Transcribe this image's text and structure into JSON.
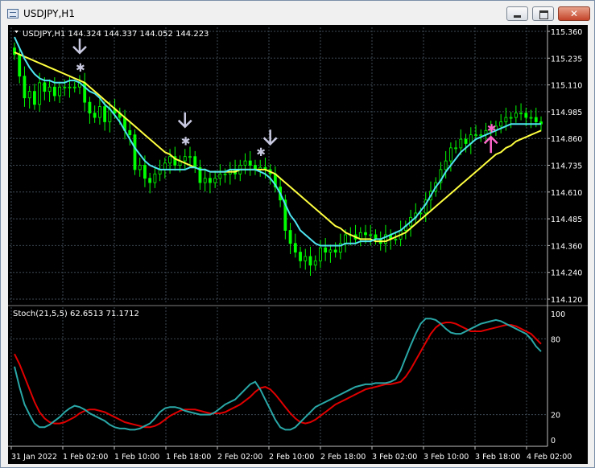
{
  "window": {
    "title": "USDJPY,H1",
    "minimize_label": "",
    "maximize_label": "",
    "close_label": "✕"
  },
  "colors": {
    "background": "#000000",
    "grid": "#3e4a55",
    "axis_text": "#ffffff",
    "bull_candle": "#00ff00",
    "ma_fast": "#4ee4f0",
    "ma_slow": "#ffff40",
    "stoch_main": "#2aa7a7",
    "stoch_signal": "#e00000",
    "signal_sell": "#c8c8e0",
    "signal_buy": "#ff66cc"
  },
  "price_panel": {
    "header": "USDJPY,H1  144.324 144.337 144.052 144.223",
    "price_labels": [
      "115.360",
      "115.235",
      "115.110",
      "114.985",
      "114.860",
      "114.735",
      "114.610",
      "114.485",
      "114.360",
      "114.240",
      "114.120"
    ],
    "signals": [
      {
        "type": "sell-arrow",
        "index": 13
      },
      {
        "type": "sell-arrow",
        "index": 34
      },
      {
        "type": "sell-arrow",
        "index": 51
      },
      {
        "type": "star",
        "index": 13
      },
      {
        "type": "star",
        "index": 34
      },
      {
        "type": "star",
        "index": 49
      },
      {
        "type": "buy-arrow",
        "index": 95
      },
      {
        "type": "buy-star",
        "index": 95
      }
    ]
  },
  "stoch_panel": {
    "header": "Stoch(21,5,5) 62.6513 71.1712",
    "levels": [
      "100",
      "80",
      "20",
      "0"
    ]
  },
  "time_labels": [
    "31 Jan 2022",
    "1 Feb 02:00",
    "1 Feb 10:00",
    "1 Feb 18:00",
    "2 Feb 02:00",
    "2 Feb 10:00",
    "2 Feb 18:00",
    "3 Feb 02:00",
    "3 Feb 10:00",
    "3 Feb 18:00",
    "4 Feb 02:00"
  ],
  "chart_data": {
    "type": "line",
    "title": "USDJPY,H1",
    "ylim": [
      114.12,
      115.36
    ],
    "x_time_labels": [
      "31 Jan 2022",
      "1 Feb 02:00",
      "1 Feb 10:00",
      "1 Feb 18:00",
      "2 Feb 02:00",
      "2 Feb 10:00",
      "2 Feb 18:00",
      "3 Feb 02:00",
      "3 Feb 10:00",
      "3 Feb 18:00",
      "4 Feb 02:00"
    ],
    "ohlc_close_approx": [
      115.25,
      115.15,
      115.05,
      115.08,
      115.02,
      115.12,
      115.08,
      115.1,
      115.06,
      115.1,
      115.1,
      115.1,
      115.1,
      115.12,
      115.03,
      114.98,
      114.96,
      115.01,
      114.94,
      115.0,
      114.98,
      114.96,
      114.9,
      114.88,
      114.72,
      114.74,
      114.68,
      114.66,
      114.7,
      114.72,
      114.75,
      114.78,
      114.74,
      114.76,
      114.78,
      114.78,
      114.73,
      114.66,
      114.68,
      114.66,
      114.68,
      114.7,
      114.7,
      114.72,
      114.7,
      114.74,
      114.76,
      114.74,
      114.72,
      114.73,
      114.72,
      114.7,
      114.64,
      114.58,
      114.44,
      114.38,
      114.34,
      114.3,
      114.32,
      114.28,
      114.3,
      114.36,
      114.34,
      114.35,
      114.34,
      114.38,
      114.42,
      114.42,
      114.4,
      114.43,
      114.42,
      114.42,
      114.4,
      114.38,
      114.42,
      114.4,
      114.4,
      114.44,
      114.46,
      114.5,
      114.52,
      114.52,
      114.58,
      114.62,
      114.66,
      114.72,
      114.76,
      114.82,
      114.82,
      114.86,
      114.84,
      114.88,
      114.88,
      114.88,
      114.9,
      114.9,
      114.92,
      114.94,
      114.96,
      114.96,
      114.98,
      114.98,
      114.96,
      114.96,
      114.94,
      114.93
    ],
    "ma_fast": [
      115.33,
      115.28,
      115.23,
      115.19,
      115.16,
      115.14,
      115.13,
      115.13,
      115.12,
      115.12,
      115.12,
      115.13,
      115.13,
      115.12,
      115.1,
      115.08,
      115.07,
      115.05,
      115.02,
      115.0,
      114.97,
      114.94,
      114.9,
      114.86,
      114.82,
      114.79,
      114.76,
      114.74,
      114.73,
      114.72,
      114.72,
      114.72,
      114.72,
      114.72,
      114.72,
      114.73,
      114.73,
      114.72,
      114.72,
      114.71,
      114.71,
      114.71,
      114.71,
      114.72,
      114.72,
      114.72,
      114.72,
      114.72,
      114.72,
      114.71,
      114.7,
      114.68,
      114.65,
      114.61,
      114.56,
      114.51,
      114.48,
      114.44,
      114.42,
      114.4,
      114.38,
      114.37,
      114.37,
      114.37,
      114.37,
      114.37,
      114.38,
      114.38,
      114.38,
      114.39,
      114.39,
      114.39,
      114.4,
      114.4,
      114.41,
      114.42,
      114.43,
      114.44,
      114.46,
      114.48,
      114.5,
      114.53,
      114.56,
      114.6,
      114.64,
      114.67,
      114.71,
      114.74,
      114.77,
      114.8,
      114.82,
      114.84,
      114.86,
      114.87,
      114.88,
      114.89,
      114.9,
      114.91,
      114.92,
      114.93,
      114.93,
      114.93,
      114.93,
      114.93,
      114.93,
      114.93
    ],
    "ma_slow": [
      115.26,
      115.25,
      115.24,
      115.23,
      115.22,
      115.21,
      115.2,
      115.19,
      115.18,
      115.17,
      115.16,
      115.15,
      115.14,
      115.13,
      115.12,
      115.1,
      115.08,
      115.06,
      115.04,
      115.02,
      115.0,
      114.98,
      114.96,
      114.94,
      114.92,
      114.9,
      114.88,
      114.86,
      114.84,
      114.82,
      114.8,
      114.79,
      114.77,
      114.76,
      114.75,
      114.74,
      114.73,
      114.72,
      114.72,
      114.71,
      114.71,
      114.71,
      114.71,
      114.71,
      114.71,
      114.72,
      114.72,
      114.72,
      114.72,
      114.72,
      114.72,
      114.71,
      114.7,
      114.68,
      114.66,
      114.64,
      114.62,
      114.6,
      114.58,
      114.56,
      114.54,
      114.52,
      114.5,
      114.48,
      114.46,
      114.45,
      114.43,
      114.42,
      114.41,
      114.4,
      114.4,
      114.4,
      114.39,
      114.39,
      114.39,
      114.4,
      114.41,
      114.42,
      114.43,
      114.45,
      114.47,
      114.49,
      114.51,
      114.53,
      114.55,
      114.57,
      114.59,
      114.61,
      114.63,
      114.65,
      114.67,
      114.69,
      114.71,
      114.73,
      114.75,
      114.77,
      114.79,
      114.8,
      114.82,
      114.83,
      114.85,
      114.86,
      114.87,
      114.88,
      114.89,
      114.9
    ],
    "stochastic": {
      "name": "Stoch(21,5,5)",
      "main_last": 62.6513,
      "signal_last": 71.1712,
      "ylim": [
        0,
        100
      ],
      "levels": [
        20,
        80
      ],
      "main": [
        58,
        42,
        28,
        20,
        13,
        10,
        10,
        12,
        15,
        18,
        22,
        25,
        27,
        26,
        24,
        21,
        19,
        17,
        15,
        12,
        10,
        9,
        9,
        8,
        8,
        9,
        11,
        13,
        17,
        22,
        25,
        26,
        26,
        25,
        23,
        22,
        21,
        20,
        20,
        20,
        22,
        25,
        28,
        30,
        32,
        36,
        40,
        44,
        46,
        40,
        32,
        24,
        16,
        10,
        8,
        8,
        10,
        14,
        18,
        22,
        26,
        28,
        30,
        32,
        34,
        36,
        38,
        40,
        42,
        43,
        44,
        44,
        45,
        45,
        45,
        46,
        48,
        55,
        65,
        75,
        84,
        92,
        96,
        96,
        95,
        92,
        88,
        85,
        84,
        84,
        86,
        88,
        90,
        92,
        93,
        94,
        95,
        94,
        92,
        90,
        88,
        86,
        84,
        80,
        74,
        70
      ],
      "signal": [
        68,
        60,
        50,
        40,
        30,
        22,
        17,
        14,
        13,
        13,
        14,
        16,
        18,
        21,
        23,
        24,
        24,
        23,
        22,
        20,
        18,
        16,
        14,
        13,
        12,
        11,
        10,
        10,
        11,
        13,
        16,
        19,
        21,
        23,
        24,
        24,
        24,
        23,
        22,
        21,
        21,
        21,
        22,
        24,
        26,
        28,
        31,
        34,
        38,
        41,
        42,
        40,
        36,
        31,
        26,
        21,
        17,
        14,
        13,
        14,
        16,
        19,
        22,
        25,
        28,
        30,
        32,
        34,
        36,
        38,
        40,
        41,
        42,
        43,
        44,
        44,
        45,
        46,
        50,
        56,
        63,
        70,
        77,
        84,
        89,
        92,
        93,
        93,
        92,
        90,
        88,
        86,
        86,
        86,
        87,
        88,
        89,
        90,
        91,
        91,
        90,
        88,
        86,
        84,
        80,
        76
      ]
    }
  }
}
